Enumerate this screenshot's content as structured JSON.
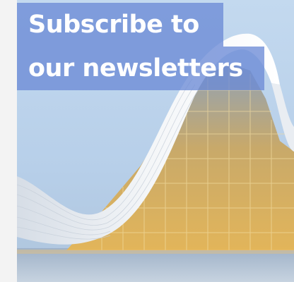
{
  "promo": {
    "headline_line_1": "Subscribe to",
    "headline_line_2": "our newsletters",
    "overlay_color": "#6c8ad6",
    "image_subject": "building-photo"
  }
}
